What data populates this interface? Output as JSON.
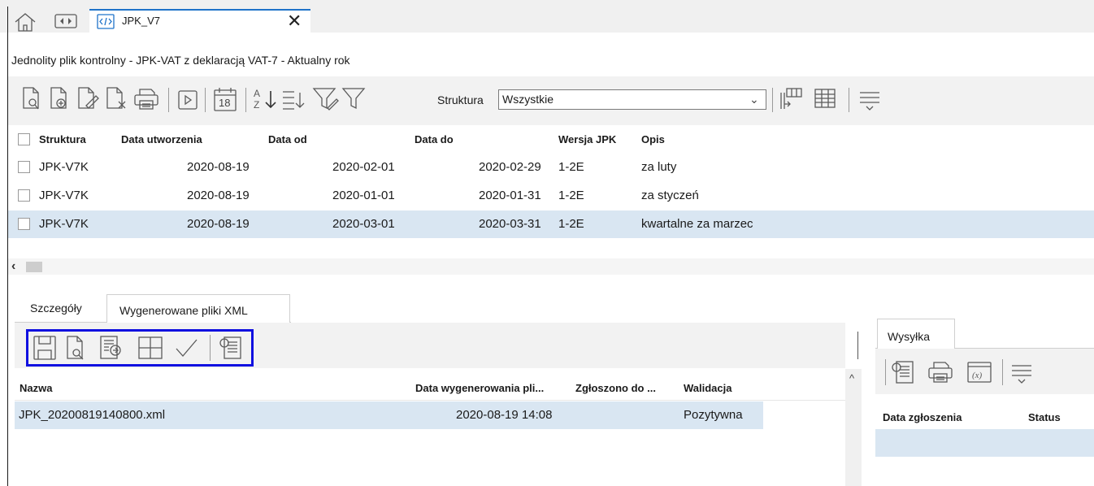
{
  "tabs": {
    "active_label": "JPK_V7"
  },
  "subtitle": "Jednolity plik kontrolny - JPK-VAT z deklaracją VAT-7 - Aktualny rok",
  "toolbar": {
    "calendar_day": "18",
    "structure_label": "Struktura",
    "structure_value": "Wszystkie"
  },
  "main_table": {
    "headers": {
      "struktura": "Struktura",
      "data_utworzenia": "Data utworzenia",
      "data_od": "Data od",
      "data_do": "Data do",
      "wersja": "Wersja JPK",
      "opis": "Opis"
    },
    "rows": [
      {
        "struktura": "JPK-V7K",
        "data_utworzenia": "2020-08-19",
        "data_od": "2020-02-01",
        "data_do": "2020-02-29",
        "wersja": "1-2E",
        "opis": "za luty",
        "selected": false
      },
      {
        "struktura": "JPK-V7K",
        "data_utworzenia": "2020-08-19",
        "data_od": "2020-01-01",
        "data_do": "2020-01-31",
        "wersja": "1-2E",
        "opis": "za styczeń",
        "selected": false
      },
      {
        "struktura": "JPK-V7K",
        "data_utworzenia": "2020-08-19",
        "data_od": "2020-03-01",
        "data_do": "2020-03-31",
        "wersja": "1-2E",
        "opis": "kwartalne za marzec",
        "selected": true
      }
    ]
  },
  "bottom_tabs": {
    "details": "Szczegóły",
    "xml_files": "Wygenerowane pliki XML"
  },
  "xml_table": {
    "headers": {
      "nazwa": "Nazwa",
      "data_wygenerowania": "Data wygenerowania pli...",
      "zgloszono": "Zgłoszono do ...",
      "walidacja": "Walidacja"
    },
    "rows": [
      {
        "nazwa": "JPK_20200819140800.xml",
        "data_wygenerowania": "2020-08-19 14:08",
        "zgloszono": "",
        "walidacja": "Pozytywna"
      }
    ]
  },
  "right_panel": {
    "tab": "Wysyłka",
    "headers": {
      "data_zgloszenia": "Data zgłoszenia",
      "status": "Status"
    }
  },
  "colors": {
    "selection": "#d9e6f2",
    "accent": "#1f73c9",
    "highlight_box": "#1010e0",
    "toolbar_bg": "#f2f2f2"
  }
}
